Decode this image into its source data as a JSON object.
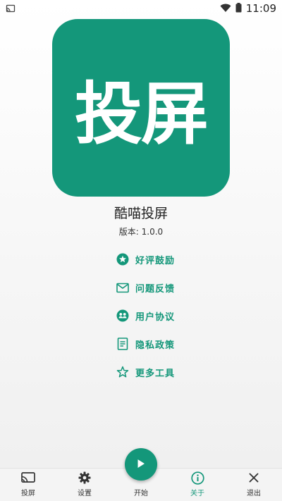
{
  "status_bar": {
    "time": "11:09"
  },
  "logo": {
    "text": "投屏"
  },
  "app": {
    "name": "酷喵投屏",
    "version_label": "版本: 1.0.0"
  },
  "menu": {
    "items": [
      {
        "label": "好评鼓励",
        "icon": "star-badge-icon"
      },
      {
        "label": "问题反馈",
        "icon": "mail-icon"
      },
      {
        "label": "用户协议",
        "icon": "users-icon"
      },
      {
        "label": "隐私政策",
        "icon": "document-icon"
      },
      {
        "label": "更多工具",
        "icon": "star-outline-icon"
      }
    ]
  },
  "tabs": [
    {
      "label": "投屏",
      "icon": "cast-icon",
      "active": false
    },
    {
      "label": "设置",
      "icon": "gear-icon",
      "active": false
    },
    {
      "label": "开始",
      "icon": "play-icon",
      "active": false
    },
    {
      "label": "关于",
      "icon": "info-icon",
      "active": true
    },
    {
      "label": "退出",
      "icon": "close-icon",
      "active": false
    }
  ],
  "colors": {
    "accent": "#14977a",
    "tab_bar_bg": "#f4f4f4",
    "text": "#222222"
  }
}
